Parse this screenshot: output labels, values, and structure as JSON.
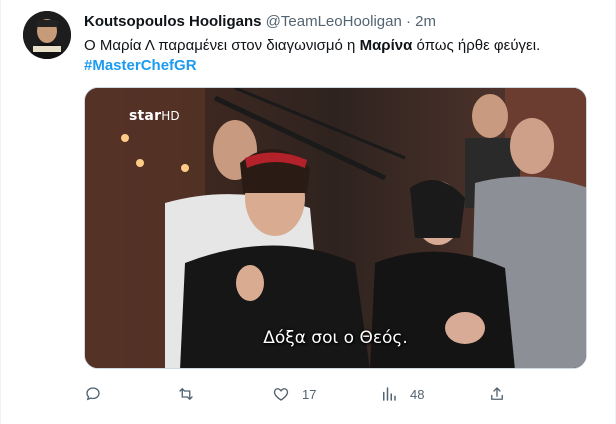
{
  "tweet": {
    "display_name": "Koutsopoulos Hooligans",
    "handle": "@TeamLeoHooligan",
    "separator": "·",
    "time": "2m",
    "text_before": "Ο Μαρία Λ παραμένει στον διαγωνισμό η ",
    "text_bold": "Μαρίνα",
    "text_after": " όπως ήρθε φεύγει.",
    "hashtag": "#MasterChefGR"
  },
  "media": {
    "channel_logo": "star",
    "channel_logo_suffix": "HD",
    "subtitle": "Δόξα σοι ο Θεός."
  },
  "actions": {
    "reply": {
      "icon": "reply-icon",
      "count": ""
    },
    "retweet": {
      "icon": "retweet-icon",
      "count": ""
    },
    "like": {
      "icon": "heart-icon",
      "count": "17"
    },
    "views": {
      "icon": "views-icon",
      "count": "48"
    },
    "share": {
      "icon": "share-icon",
      "count": ""
    }
  },
  "colors": {
    "text": "#0f1419",
    "secondary": "#536471",
    "accent": "#1d9bf0",
    "border": "#eff3f4"
  }
}
